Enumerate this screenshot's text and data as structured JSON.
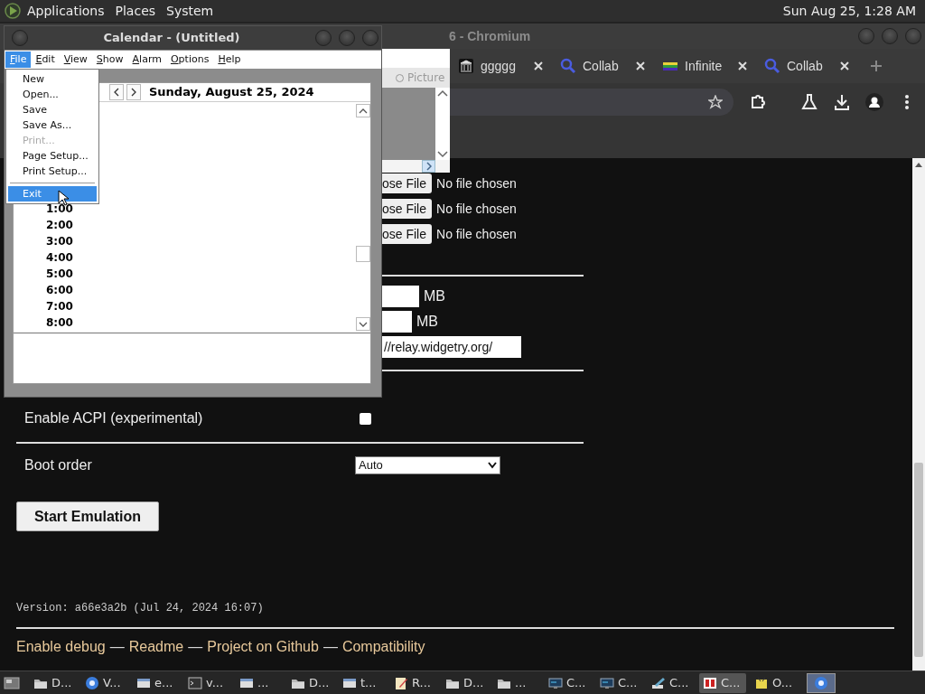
{
  "top_panel": {
    "menus": [
      "Applications",
      "Places",
      "System"
    ],
    "clock": "Sun Aug 25, 1:28 AM"
  },
  "browser": {
    "title": "6 - Chromium",
    "tabs": [
      {
        "label": "ggggg",
        "kind": "museum",
        "selected": false
      },
      {
        "label": "Collab",
        "kind": "search",
        "selected": false
      },
      {
        "label": "Infinite",
        "kind": "rainbow",
        "selected": false
      },
      {
        "label": "Collab",
        "kind": "search",
        "selected": false
      }
    ],
    "page": {
      "file_rows": [
        {
          "button": "ose File",
          "status": "No file chosen"
        },
        {
          "button": "ose File",
          "status": "No file chosen"
        },
        {
          "button": "ose File",
          "status": "No file chosen"
        }
      ],
      "memory_units": [
        "MB",
        "MB"
      ],
      "relay_url": "//relay.widgetry.org/",
      "acpi": {
        "label": "Enable ACPI (experimental)",
        "checked": false
      },
      "boot_order": {
        "label": "Boot order",
        "value": "Auto"
      },
      "start_button": "Start Emulation",
      "version": "Version: a66e3a2b (Jul 24, 2024 16:07)",
      "footer": [
        {
          "kind": "link",
          "text": "Enable debug"
        },
        {
          "kind": "separator",
          "text": "—"
        },
        {
          "kind": "link",
          "text": "Readme"
        },
        {
          "kind": "separator",
          "text": "—"
        },
        {
          "kind": "link",
          "text": "Project on Github"
        },
        {
          "kind": "separator",
          "text": "—"
        },
        {
          "kind": "link",
          "text": "Compatibility"
        }
      ]
    }
  },
  "background_window": {
    "option": {
      "label": "Picture",
      "selected": false
    }
  },
  "calendar": {
    "title": "Calendar - (Untitled)",
    "menu": [
      {
        "label": "File",
        "selected": true
      },
      {
        "label": "Edit",
        "selected": false
      },
      {
        "label": "View",
        "selected": false
      },
      {
        "label": "Show",
        "selected": false
      },
      {
        "label": "Alarm",
        "selected": false
      },
      {
        "label": "Options",
        "selected": false
      },
      {
        "label": "Help",
        "selected": false
      }
    ],
    "date": "Sunday, August 25, 2024",
    "times": [
      "1:00",
      "2:00",
      "3:00",
      "4:00",
      "5:00",
      "6:00",
      "7:00",
      "8:00"
    ],
    "file_menu": [
      {
        "kind": "item",
        "label": "New",
        "disabled": false,
        "selected": false
      },
      {
        "kind": "item",
        "label": "Open...",
        "disabled": false,
        "selected": false
      },
      {
        "kind": "item",
        "label": "Save",
        "disabled": false,
        "selected": false
      },
      {
        "kind": "item",
        "label": "Save As...",
        "disabled": false,
        "selected": false
      },
      {
        "kind": "item",
        "label": "Print...",
        "disabled": true,
        "selected": false
      },
      {
        "kind": "item",
        "label": "Page Setup...",
        "disabled": false,
        "selected": false
      },
      {
        "kind": "item",
        "label": "Print Setup...",
        "disabled": false,
        "selected": false
      },
      {
        "kind": "separator"
      },
      {
        "kind": "item",
        "label": "Exit",
        "disabled": false,
        "selected": true
      }
    ]
  },
  "taskbar": {
    "items": [
      {
        "label": "D...",
        "kind": "folder",
        "selected": false
      },
      {
        "label": "V...",
        "kind": "browser",
        "selected": false
      },
      {
        "label": "e...",
        "kind": "window",
        "selected": false
      },
      {
        "label": "v...",
        "kind": "terminal",
        "selected": false
      },
      {
        "label": "...",
        "kind": "window",
        "selected": false
      },
      {
        "label": "D...",
        "kind": "folder",
        "selected": false
      },
      {
        "label": "t...",
        "kind": "window",
        "selected": false
      },
      {
        "label": "R...",
        "kind": "editor",
        "selected": false
      },
      {
        "label": "D...",
        "kind": "folder",
        "selected": false
      },
      {
        "label": "...",
        "kind": "folder",
        "selected": false
      },
      {
        "label": "C...",
        "kind": "monitor",
        "selected": false
      },
      {
        "label": "C...",
        "kind": "monitor",
        "selected": false
      },
      {
        "label": "C...",
        "kind": "pen",
        "selected": false
      },
      {
        "label": "C...",
        "kind": "calendar",
        "selected": true
      },
      {
        "label": "O...",
        "kind": "app",
        "selected": false
      }
    ],
    "workspace": {
      "selected": true
    }
  }
}
